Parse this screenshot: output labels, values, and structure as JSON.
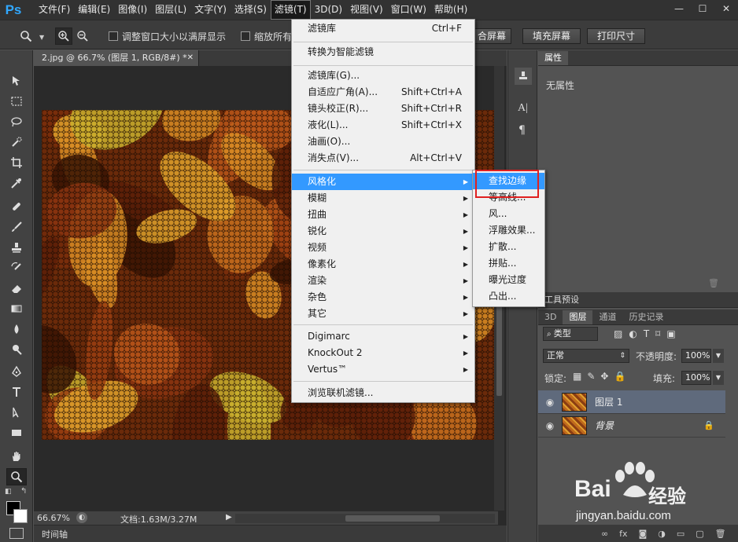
{
  "menubar": {
    "logo": "Ps",
    "items": [
      "文件(F)",
      "编辑(E)",
      "图像(I)",
      "图层(L)",
      "文字(Y)",
      "选择(S)",
      "滤镜(T)",
      "3D(D)",
      "视图(V)",
      "窗口(W)",
      "帮助(H)"
    ],
    "active_index": 6,
    "win_minimize": "—",
    "win_restore": "☐",
    "win_close": "✕"
  },
  "options": {
    "resize_windows": "调整窗口大小以满屏显示",
    "zoom_all": "缩放所有",
    "fit_screen": "合屏幕",
    "fill_screen": "填充屏幕",
    "print_size": "打印尺寸"
  },
  "document": {
    "tab_title": "2.jpg @ 66.7% (图层 1, RGB/8#) *",
    "tab_close": "✕",
    "zoom": "66.67%",
    "doc_info": "文档:1.63M/3.27M",
    "timeline_label": "时间轴"
  },
  "filter_menu": {
    "items": [
      {
        "label": "滤镜库",
        "shortcut": "Ctrl+F"
      },
      {
        "label": "转换为智能滤镜",
        "shortcut": ""
      },
      {
        "label": "滤镜库(G)...",
        "shortcut": ""
      },
      {
        "label": "自适应广角(A)...",
        "shortcut": "Shift+Ctrl+A"
      },
      {
        "label": "镜头校正(R)...",
        "shortcut": "Shift+Ctrl+R"
      },
      {
        "label": "液化(L)...",
        "shortcut": "Shift+Ctrl+X"
      },
      {
        "label": "油画(O)...",
        "shortcut": ""
      },
      {
        "label": "消失点(V)...",
        "shortcut": "Alt+Ctrl+V"
      },
      {
        "label": "风格化",
        "shortcut": ""
      },
      {
        "label": "模糊",
        "shortcut": ""
      },
      {
        "label": "扭曲",
        "shortcut": ""
      },
      {
        "label": "锐化",
        "shortcut": ""
      },
      {
        "label": "视频",
        "shortcut": ""
      },
      {
        "label": "像素化",
        "shortcut": ""
      },
      {
        "label": "渲染",
        "shortcut": ""
      },
      {
        "label": "杂色",
        "shortcut": ""
      },
      {
        "label": "其它",
        "shortcut": ""
      },
      {
        "label": "Digimarc",
        "shortcut": ""
      },
      {
        "label": "KnockOut 2",
        "shortcut": ""
      },
      {
        "label": "Vertus™",
        "shortcut": ""
      },
      {
        "label": "浏览联机滤镜...",
        "shortcut": ""
      }
    ]
  },
  "stylize_submenu": {
    "items": [
      "查找边缘",
      "等高线...",
      "风...",
      "浮雕效果...",
      "扩散...",
      "拼贴...",
      "曝光过度",
      "凸出..."
    ]
  },
  "properties_panel": {
    "tab": "属性",
    "empty_text": "无属性"
  },
  "tool_presets": {
    "label": "工具预设"
  },
  "layers_panel": {
    "tabs": [
      "3D",
      "图层",
      "通道",
      "历史记录"
    ],
    "filter_kind": "类型",
    "blend_mode": "正常",
    "opacity_label": "不透明度:",
    "opacity_value": "100%",
    "lock_label": "锁定:",
    "fill_label": "填充:",
    "fill_value": "100%",
    "layers": [
      {
        "name": "图层 1"
      },
      {
        "name": "背景"
      }
    ]
  },
  "watermark": {
    "brand": "Bai",
    "brand2": "经验",
    "url": "jingyan.baidu.com"
  },
  "colors": {
    "accent": "#3399ff",
    "highlight_box": "#e02020"
  }
}
